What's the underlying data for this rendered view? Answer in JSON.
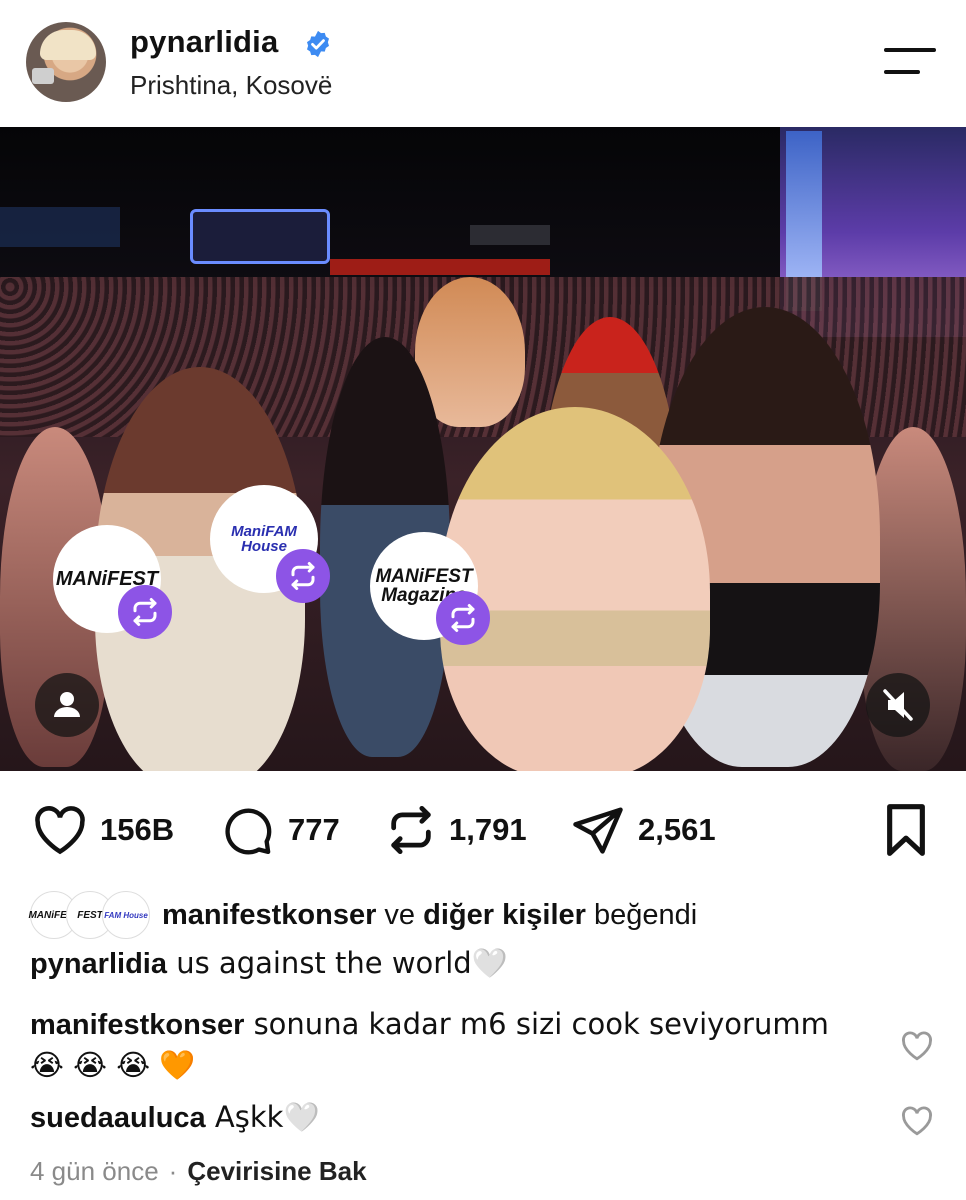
{
  "header": {
    "username": "pynarlidia",
    "location": "Prishtina, Kosovë",
    "verified_color": "#3d8bf2"
  },
  "post": {
    "collaborators": [
      {
        "label": "MANiFEST"
      },
      {
        "label": "ManiFAM House"
      },
      {
        "label": "MANiFEST Magazine"
      }
    ],
    "repost_badge_color": "#8d54e6"
  },
  "actions": {
    "likes": "156B",
    "comments": "777",
    "reposts": "1,791",
    "shares": "2,561"
  },
  "liked_by": {
    "avatars": [
      "MANiFEST",
      "FEST",
      "FAM House"
    ],
    "name": "manifestkonser",
    "connector": " ve ",
    "others": "diğer kişiler",
    "suffix": " beğendi"
  },
  "caption": {
    "user": "pynarlidia",
    "text": " us against the world🤍"
  },
  "comments": [
    {
      "user": "manifestkonser",
      "text": " sonuna kadar m6 sizi cook seviyorumm 😭 😭 😭 🧡"
    },
    {
      "user": "suedaauluca",
      "text": " Aşkk🤍"
    }
  ],
  "meta": {
    "time": "4 gün önce",
    "separator": "·",
    "translate": "Çevirisine Bak"
  }
}
